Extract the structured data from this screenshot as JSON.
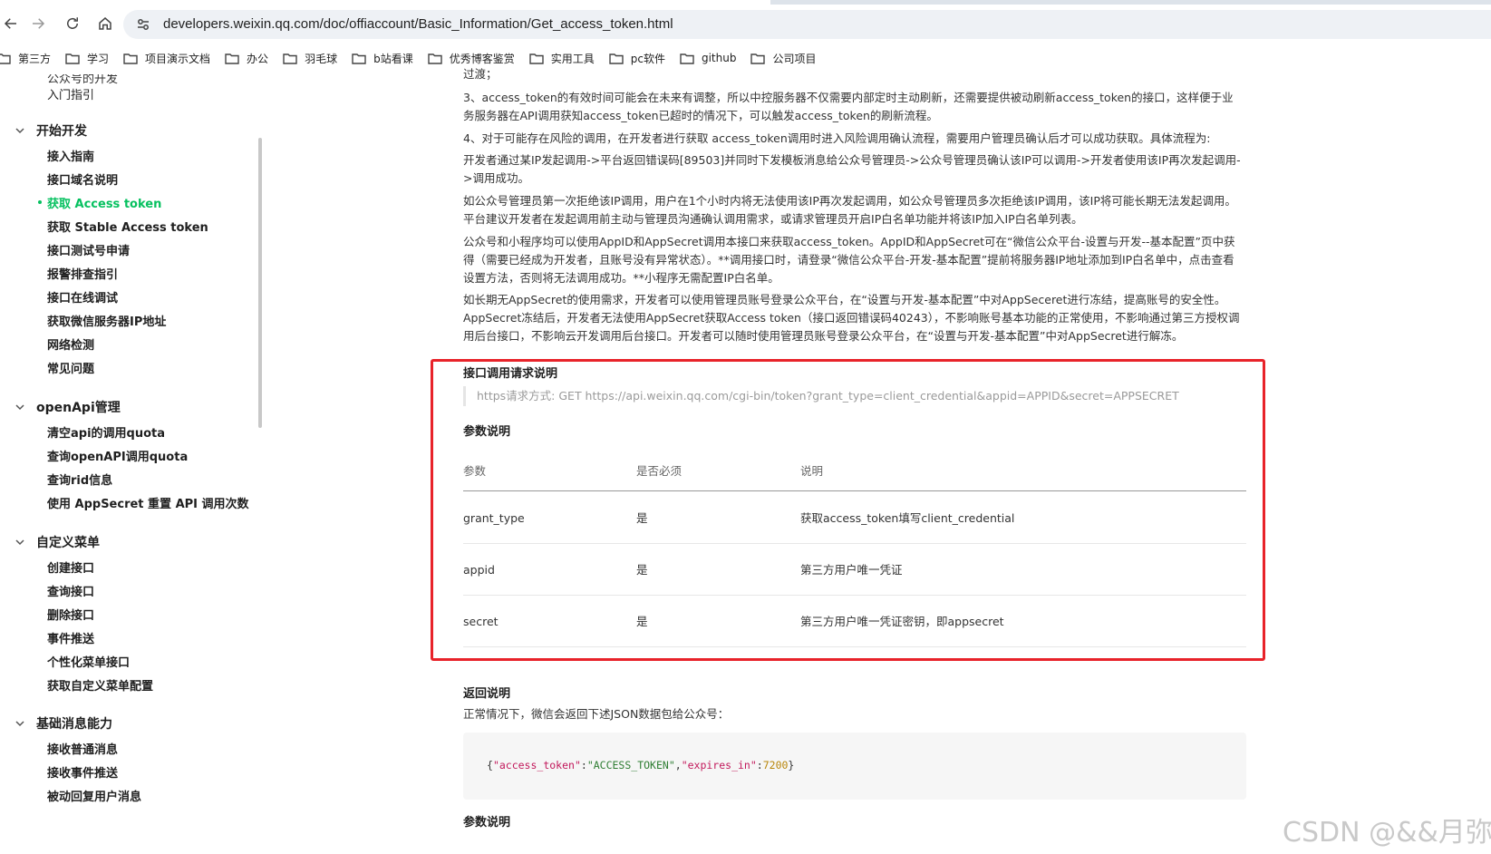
{
  "browser": {
    "url": "developers.weixin.qq.com/doc/offiaccount/Basic_Information/Get_access_token.html",
    "bookmarks": [
      "第三方",
      "学习",
      "项目演示文档",
      "办公",
      "羽毛球",
      "b站看课",
      "优秀博客鉴赏",
      "实用工具",
      "pc软件",
      "github",
      "公司项目"
    ]
  },
  "sidebar": {
    "partial_top": "公众号的开发",
    "intro": "入门指引",
    "groups": [
      {
        "title": "开始开发",
        "items": [
          "接入指南",
          "接口域名说明",
          "获取 Access token",
          "获取 Stable Access token",
          "接口测试号申请",
          "报警排查指引",
          "接口在线调试",
          "获取微信服务器IP地址",
          "网络检测",
          "常见问题"
        ]
      },
      {
        "title": "openApi管理",
        "items": [
          "清空api的调用quota",
          "查询openAPI调用quota",
          "查询rid信息",
          "使用 AppSecret 重置 API 调用次数"
        ]
      },
      {
        "title": "自定义菜单",
        "items": [
          "创建接口",
          "查询接口",
          "删除接口",
          "事件推送",
          "个性化菜单接口",
          "获取自定义菜单配置"
        ]
      },
      {
        "title": "基础消息能力",
        "items": [
          "接收普通消息",
          "接收事件推送",
          "被动回复用户消息"
        ]
      }
    ],
    "active_item": "获取 Access token"
  },
  "content": {
    "partial_top": "过渡；",
    "para3": "3、access_token的有效时间可能会在未来有调整，所以中控服务器不仅需要内部定时主动刷新，还需要提供被动刷新access_token的接口，这样便于业务服务器在API调用获知access_token已超时的情况下，可以触发access_token的刷新流程。",
    "para4": "4、对于可能存在风险的调用，在开发者进行获取 access_token调用时进入风险调用确认流程，需要用户管理员确认后才可以成功获取。具体流程为:",
    "para5": "开发者通过某IP发起调用->平台返回错误码[89503]并同时下发模板消息给公众号管理员->公众号管理员确认该IP可以调用->开发者使用该IP再次发起调用->调用成功。",
    "para6": "如公众号管理员第一次拒绝该IP调用，用户在1个小时内将无法使用该IP再次发起调用，如公众号管理员多次拒绝该IP调用，该IP将可能长期无法发起调用。平台建议开发者在发起调用前主动与管理员沟通确认调用需求，或请求管理员开启IP白名单功能并将该IP加入IP白名单列表。",
    "para7": "公众号和小程序均可以使用AppID和AppSecret调用本接口来获取access_token。AppID和AppSecret可在“微信公众平台-设置与开发--基本配置”页中获得（需要已经成为开发者，且账号没有异常状态）。**调用接口时，请登录“微信公众平台-开发-基本配置”提前将服务器IP地址添加到IP白名单中，点击查看设置方法，否则将无法调用成功。**小程序无需配置IP白名单。",
    "para8": "如长期无AppSecret的使用需求，开发者可以使用管理员账号登录公众平台，在“设置与开发-基本配置”中对AppSeceret进行冻结，提高账号的安全性。AppSecret冻结后，开发者无法使用AppSecret获取Access token（接口返回错误码40243），不影响账号基本功能的正常使用，不影响通过第三方授权调用后台接口，不影响云开发调用后台接口。开发者可以随时使用管理员账号登录公众平台，在“设置与开发-基本配置”中对AppSecret进行解冻。",
    "request_title": "接口调用请求说明",
    "request_line": "https请求方式: GET https://api.weixin.qq.com/cgi-bin/token?grant_type=client_credential&appid=APPID&secret=APPSECRET",
    "params_title": "参数说明",
    "table": {
      "headers": [
        "参数",
        "是否必须",
        "说明"
      ],
      "rows": [
        [
          "grant_type",
          "是",
          "获取access_token填写client_credential"
        ],
        [
          "appid",
          "是",
          "第三方用户唯一凭证"
        ],
        [
          "secret",
          "是",
          "第三方用户唯一凭证密钥，即appsecret"
        ]
      ]
    },
    "return_title": "返回说明",
    "return_desc": "正常情况下，微信会返回下述JSON数据包给公众号：",
    "code": {
      "key1": "\"access_token\"",
      "val1": "\"ACCESS_TOKEN\"",
      "key2": "\"expires_in\"",
      "val2": "7200"
    },
    "params_title2": "参数说明"
  },
  "watermark": "CSDN @&&月弥",
  "colors": {
    "accent": "#07c160",
    "highlight": "#e8232a"
  }
}
